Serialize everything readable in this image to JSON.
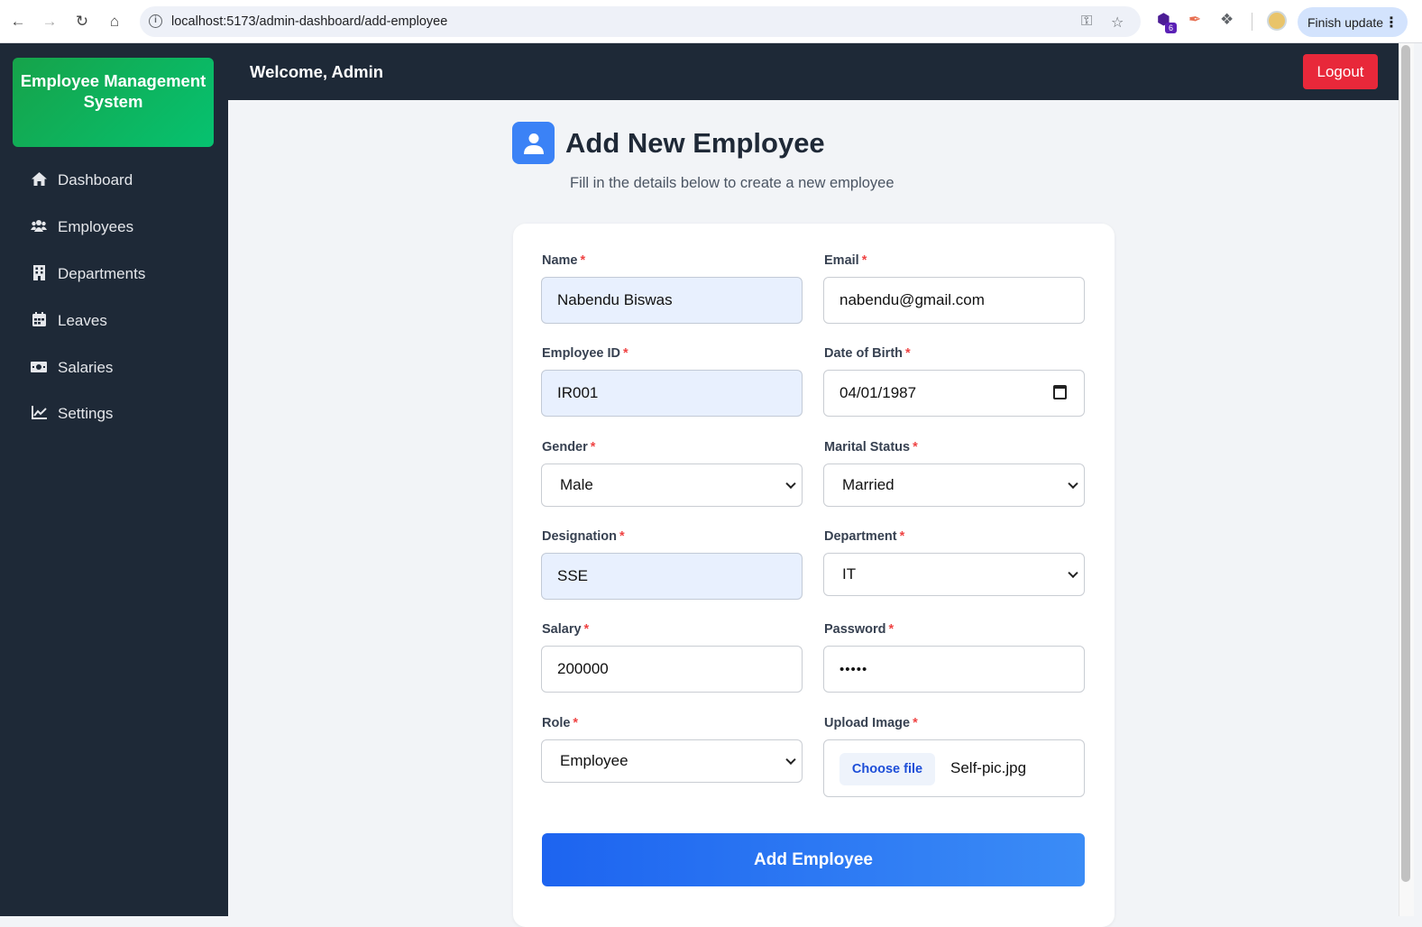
{
  "browser": {
    "url": "localhost:5173/admin-dashboard/add-employee",
    "extension_badge": "6",
    "finish_update_label": "Finish update"
  },
  "sidebar": {
    "brand": "Employee Management System",
    "items": [
      {
        "label": "Dashboard",
        "icon": "home-icon"
      },
      {
        "label": "Employees",
        "icon": "users-icon"
      },
      {
        "label": "Departments",
        "icon": "building-icon"
      },
      {
        "label": "Leaves",
        "icon": "calendar-icon"
      },
      {
        "label": "Salaries",
        "icon": "money-icon"
      },
      {
        "label": "Settings",
        "icon": "chart-line-icon"
      }
    ]
  },
  "topbar": {
    "welcome": "Welcome, Admin",
    "logout_label": "Logout"
  },
  "header": {
    "title": "Add New Employee",
    "subtitle": "Fill in the details below to create a new employee"
  },
  "form": {
    "name": {
      "label": "Name",
      "value": "Nabendu Biswas"
    },
    "email": {
      "label": "Email",
      "value": "nabendu@gmail.com"
    },
    "employee_id": {
      "label": "Employee ID",
      "value": "IR001"
    },
    "dob": {
      "label": "Date of Birth",
      "value": "04/01/1987"
    },
    "gender": {
      "label": "Gender",
      "value": "Male"
    },
    "marital_status": {
      "label": "Marital Status",
      "value": "Married"
    },
    "designation": {
      "label": "Designation",
      "value": "SSE"
    },
    "department": {
      "label": "Department",
      "value": "IT"
    },
    "salary": {
      "label": "Salary",
      "value": "200000"
    },
    "password": {
      "label": "Password",
      "value": "•••••"
    },
    "role": {
      "label": "Role",
      "value": "Employee"
    },
    "upload": {
      "label": "Upload Image",
      "button": "Choose file",
      "filename": "Self-pic.jpg"
    },
    "required_marker": "*",
    "submit_label": "Add Employee"
  },
  "colors": {
    "sidebar_bg": "#1e2937",
    "brand_green": "#16a34a",
    "logout_red": "#e8283a",
    "accent_blue": "#3b82f6",
    "required_red": "#ef4444"
  }
}
